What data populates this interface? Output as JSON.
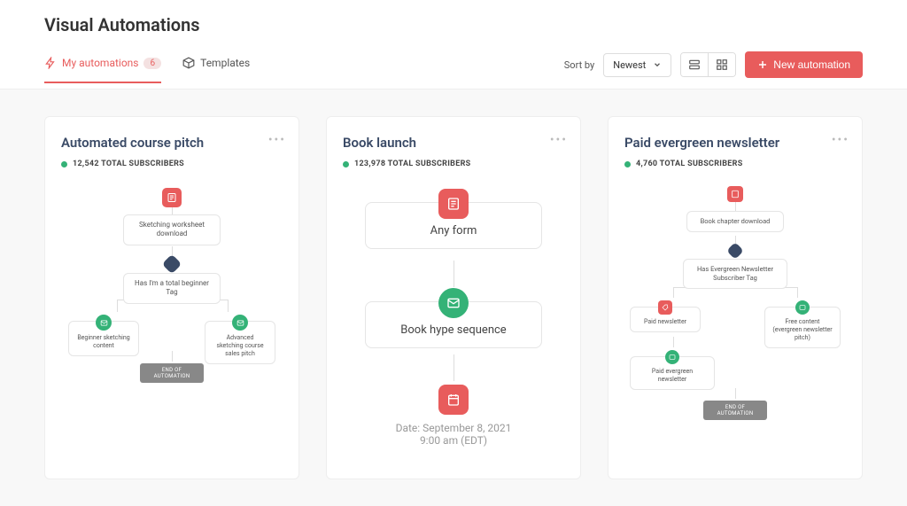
{
  "page_title": "Visual Automations",
  "tabs": {
    "my_automations": {
      "label": "My automations",
      "count": "6"
    },
    "templates": {
      "label": "Templates"
    }
  },
  "sort": {
    "label": "Sort by",
    "selected": "Newest"
  },
  "new_button": "New automation",
  "cards": [
    {
      "title": "Automated course pitch",
      "subscribers": "12,542 TOTAL SUBSCRIBERS",
      "entry": "Sketching worksheet download",
      "condition": "Has I'm a total beginner Tag",
      "branch_left": "Beginner sketching content",
      "branch_right": "Advanced sketching course sales pitch",
      "end": "END OF AUTOMATION"
    },
    {
      "title": "Book launch",
      "subscribers": "123,978 TOTAL SUBSCRIBERS",
      "entry": "Any form",
      "sequence": "Book hype sequence",
      "date_line1": "Date: September 8, 2021",
      "date_line2": "9:00 am (EDT)"
    },
    {
      "title": "Paid evergreen newsletter",
      "subscribers": "4,760 TOTAL SUBSCRIBERS",
      "entry": "Book chapter download",
      "condition": "Has Evergreen Newsletter Subscriber Tag",
      "branch_left": "Paid newsletter",
      "branch_right": "Free content (evergreen newsletter pitch)",
      "next": "Paid evergreen newsletter",
      "end": "END OF AUTOMATION"
    }
  ]
}
